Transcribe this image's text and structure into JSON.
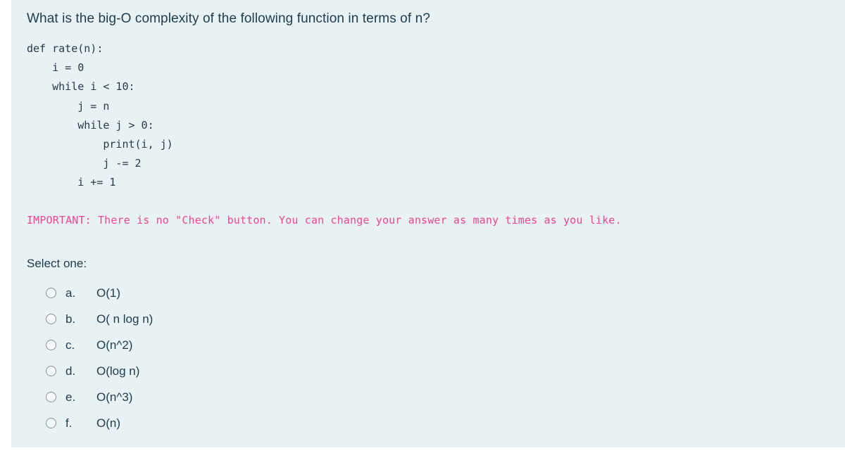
{
  "panel": {
    "background_color": "#e8f1f4",
    "page_background_color": "#ffffff"
  },
  "question": {
    "text": "What is the big-O complexity of the following function in terms of n?",
    "text_color": "#1d3c4d"
  },
  "code": {
    "language": "python",
    "text_color": "#263a4a",
    "body": "def rate(n):\n    i = 0\n    while i < 10:\n        j = n\n        while j > 0:\n            print(i, j)\n            j -= 2\n        i += 1"
  },
  "important_note": {
    "text": "IMPORTANT: There is no \"Check\" button. You can change your answer as many times as you like.",
    "color": "#f0468c"
  },
  "select_prompt": {
    "label": "Select one:"
  },
  "options": [
    {
      "letter": "a.",
      "text": "O(1)",
      "selected": false
    },
    {
      "letter": "b.",
      "text": "O( n log n)",
      "selected": false
    },
    {
      "letter": "c.",
      "text": "O(n^2)",
      "selected": false
    },
    {
      "letter": "d.",
      "text": "O(log n)",
      "selected": false
    },
    {
      "letter": "e.",
      "text": "O(n^3)",
      "selected": false
    },
    {
      "letter": "f.",
      "text": "O(n)",
      "selected": false
    }
  ]
}
